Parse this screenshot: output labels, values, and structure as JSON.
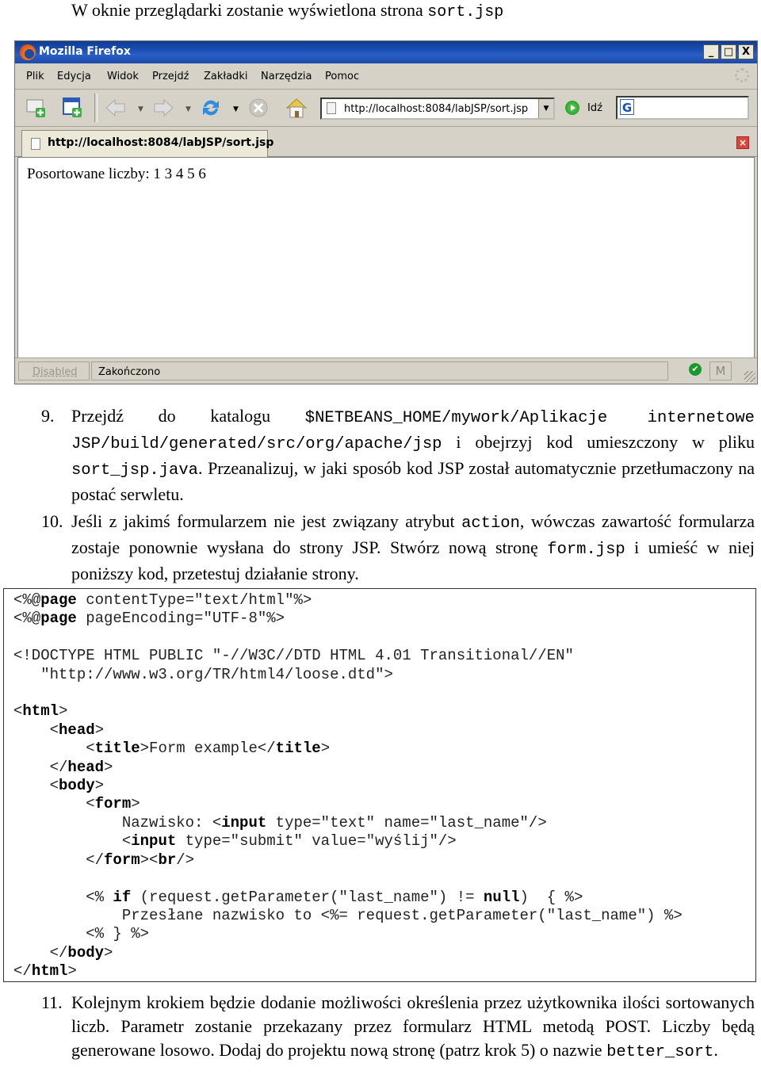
{
  "intro": {
    "text": "W oknie przeglądarki zostanie wyświetlona strona ",
    "code": "sort.jsp"
  },
  "browser": {
    "title": "Mozilla Firefox",
    "window_buttons": [
      "_",
      "□",
      "X"
    ],
    "menu": [
      "Plik",
      "Edycja",
      "Widok",
      "Przejdź",
      "Zakładki",
      "Narzędzia",
      "Pomoc"
    ],
    "toolbar_icons": [
      "new-window-icon",
      "new-tab-icon",
      "back-icon",
      "forward-icon",
      "reload-icon",
      "stop-icon",
      "home-icon"
    ],
    "address": "http://localhost:8084/labJSP/sort.jsp",
    "go_label": "Idź",
    "search_engine": "G",
    "tab_title": "http://localhost:8084/labJSP/sort.jsp",
    "page_content": "Posortowane liczby: 1 3 4 5 6",
    "status": {
      "left": "Disabled",
      "message": "Zakończono"
    }
  },
  "steps": [
    {
      "number": "9.",
      "parts": [
        {
          "t": "Przejdź do katalogu "
        },
        {
          "c": "$NETBEANS_HOME/mywork/Aplikacje internetowe JSP/build/generated/src/org/apache/jsp"
        },
        {
          "t": " i obejrzyj kod umieszczony w pliku "
        },
        {
          "c": "sort_jsp.java"
        },
        {
          "t": ". Przeanalizuj, w jaki sposób kod JSP został automatycznie przetłumaczony na postać serwletu."
        }
      ]
    },
    {
      "number": "10.",
      "parts": [
        {
          "t": "Jeśli z jakimś formularzem nie jest związany atrybut "
        },
        {
          "c": "action"
        },
        {
          "t": ", wówczas zawartość formularza zostaje ponownie wysłana do strony JSP. Stwórz nową stronę "
        },
        {
          "c": "form.jsp"
        },
        {
          "t": " i umieść w niej poniższy kod, przetestuj działanie strony."
        }
      ]
    },
    {
      "number": "11.",
      "parts": [
        {
          "t": "Kolejnym krokiem będzie dodanie możliwości określenia przez użytkownika ilości sortowanych liczb. Parametr zostanie przekazany przez formularz HTML metodą POST. Liczby będą generowane losowo. Dodaj do projektu nową stronę (patrz krok 5) o nazwie "
        },
        {
          "c": "better_sort"
        },
        {
          "t": "."
        }
      ]
    }
  ],
  "code_lines": [
    [
      [
        "<%@"
      ],
      [
        "page",
        1
      ],
      [
        " contentType=\"text/html\"%>"
      ]
    ],
    [
      [
        "<%@"
      ],
      [
        "page",
        1
      ],
      [
        " pageEncoding=\"UTF-8\"%>"
      ]
    ],
    [
      [
        ""
      ]
    ],
    [
      [
        "<!DOCTYPE HTML PUBLIC \"-//W3C//DTD HTML 4.01 Transitional//EN\""
      ]
    ],
    [
      [
        "   \"http://www.w3.org/TR/html4/loose.dtd\">"
      ]
    ],
    [
      [
        ""
      ]
    ],
    [
      [
        "<"
      ],
      [
        "html",
        1
      ],
      [
        ">"
      ]
    ],
    [
      [
        "    <"
      ],
      [
        "head",
        1
      ],
      [
        ">"
      ]
    ],
    [
      [
        "        <"
      ],
      [
        "title",
        1
      ],
      [
        ">Form example</"
      ],
      [
        "title",
        1
      ],
      [
        ">"
      ]
    ],
    [
      [
        "    </"
      ],
      [
        "head",
        1
      ],
      [
        ">"
      ]
    ],
    [
      [
        "    <"
      ],
      [
        "body",
        1
      ],
      [
        ">"
      ]
    ],
    [
      [
        "        <"
      ],
      [
        "form",
        1
      ],
      [
        ">"
      ]
    ],
    [
      [
        "            Nazwisko: <"
      ],
      [
        "input",
        1
      ],
      [
        " type=\"text\" name=\"last_name\"/>"
      ]
    ],
    [
      [
        "            <"
      ],
      [
        "input",
        1
      ],
      [
        " type=\"submit\" value=\"wyślij\"/>"
      ]
    ],
    [
      [
        "        </"
      ],
      [
        "form",
        1
      ],
      [
        "><"
      ],
      [
        "br",
        1
      ],
      [
        "/>"
      ]
    ],
    [
      [
        ""
      ]
    ],
    [
      [
        "        <% "
      ],
      [
        "if",
        1
      ],
      [
        " (request.getParameter(\"last_name\") != "
      ],
      [
        "null",
        1
      ],
      [
        ")  { %>"
      ]
    ],
    [
      [
        "            Przesłane nazwisko to <%= request.getParameter(\"last_name\") %>"
      ]
    ],
    [
      [
        "        <% } %>"
      ]
    ],
    [
      [
        "    </"
      ],
      [
        "body",
        1
      ],
      [
        ">"
      ]
    ],
    [
      [
        "</"
      ],
      [
        "html",
        1
      ],
      [
        ">"
      ]
    ]
  ]
}
